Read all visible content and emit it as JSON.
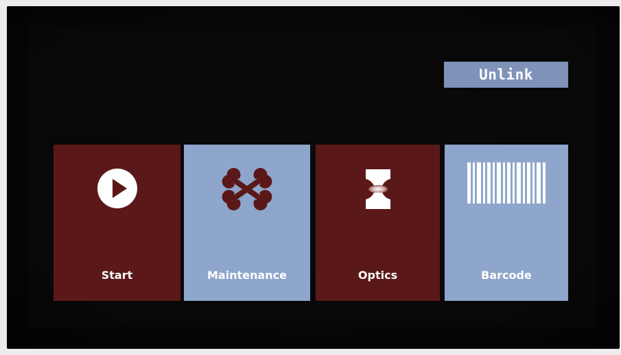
{
  "unlink_button": {
    "label": "Unlink"
  },
  "tiles": [
    {
      "label": "Start",
      "icon": "play-icon",
      "color": "#5b1818"
    },
    {
      "label": "Maintenance",
      "icon": "wrench-icon",
      "color": "#8ea6cb"
    },
    {
      "label": "Optics",
      "icon": "optics-icon",
      "color": "#5b1818"
    },
    {
      "label": "Barcode",
      "icon": "barcode-icon",
      "color": "#8ea6cb"
    }
  ],
  "colors": {
    "accent_dark_red": "#5b1818",
    "accent_light_blue": "#8ea6cb",
    "unlink_blue": "#7f93b8",
    "background": "#050505"
  }
}
